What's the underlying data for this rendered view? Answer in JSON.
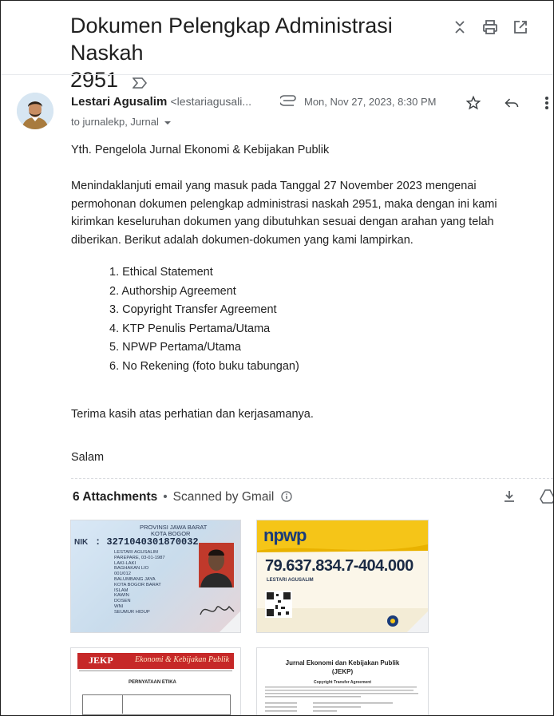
{
  "subject": {
    "title_line1": "Dokumen Pelengkap Administrasi Naskah",
    "title_line2": "2951"
  },
  "message": {
    "sender_name": "Lestari Agusalim",
    "sender_email": "<lestariagusali...",
    "date": "Mon, Nov 27, 2023, 8:30 PM",
    "to_line": "to jurnalekp, Jurnal",
    "greeting": "Yth. Pengelola Jurnal Ekonomi & Kebijakan Publik",
    "para1_l1": "Menindaklanjuti email yang masuk pada Tanggal 27 November 2023 mengenai",
    "para1_l2": "permohonan dokumen pelengkap administrasi naskah 2951, maka dengan ini kami",
    "para1_l3": "kirimkan keseluruhan dokumen yang dibutuhkan sesuai dengan arahan yang telah",
    "para1_l4": "diberikan. Berikut adalah dokumen-dokumen yang kami lampirkan.",
    "list": [
      "1. Ethical Statement",
      "2. Authorship Agreement",
      "3. Copyright Transfer Agreement",
      "4. KTP Penulis Pertama/Utama",
      "5. NPWP Pertama/Utama",
      "6. No Rekening (foto buku tabungan)"
    ],
    "closing": "Terima kasih atas perhatian dan kerjasamanya.",
    "signoff": "Salam"
  },
  "attachments": {
    "count_label": "6 Attachments",
    "scan_label": "Scanned by Gmail",
    "ktp": {
      "province": "PROVINSI JAWA BARAT",
      "city": "KOTA BOGOR",
      "nik_label": "NIK",
      "nik": ": 3271040301870032",
      "fields": [
        "LESTARI AGUSALIM",
        "PAREPARE, 03-01-1987",
        "LAKI-LAKI",
        "BAGHAKAN LIO",
        "001/012",
        "BALUMBANG JAYA",
        "KOTA BOGOR BARAT",
        "ISLAM",
        "KAWIN",
        "DOSEN",
        "WNI",
        "SEUMUR HIDUP"
      ]
    },
    "npwp": {
      "logo": "npwp",
      "number": "79.637.834.7-404.000",
      "name": "LESTARI AGUSALIM"
    },
    "doc1": {
      "journal": "Ekonomi & Kebijakan Publik",
      "badge": "JEKP",
      "heading": "PERNYATAAN ETIKA"
    },
    "doc2": {
      "journal": "Jurnal Ekonomi dan Kebijakan Publik",
      "abbr": "(JEKP)",
      "heading": "Copyright Transfer Agreement"
    }
  },
  "colors": {
    "npwp_yellow": "#f5c518",
    "npwp_blue": "#1a3c7a",
    "jekp_red": "#c62828"
  }
}
